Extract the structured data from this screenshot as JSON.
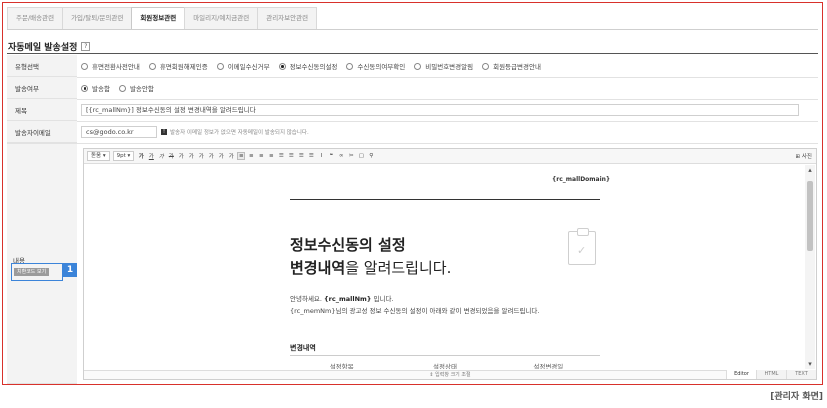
{
  "tabs": [
    {
      "label": "주문/배송관련"
    },
    {
      "label": "가입/탈퇴/문의관련"
    },
    {
      "label": "회원정보관련"
    },
    {
      "label": "마일리지/예치금관련"
    },
    {
      "label": "관리자보안관련"
    }
  ],
  "active_tab": "회원정보관련",
  "section": {
    "title": "자동메일 발송설정",
    "help": "?"
  },
  "form": {
    "type_label": "유형선택",
    "type_options": [
      {
        "label": "휴면전환사전안내",
        "checked": false
      },
      {
        "label": "휴면회원해제인증",
        "checked": false
      },
      {
        "label": "이메일수신거부",
        "checked": false
      },
      {
        "label": "정보수신동의설정",
        "checked": true
      },
      {
        "label": "수신동의여부확인",
        "checked": false
      },
      {
        "label": "비밀번호변경알림",
        "checked": false
      },
      {
        "label": "회원등급변경안내",
        "checked": false
      }
    ],
    "send_label": "발송여부",
    "send_options": [
      {
        "label": "발송함",
        "checked": true
      },
      {
        "label": "발송안함",
        "checked": false
      }
    ],
    "subject_label": "제목",
    "subject_value": "[{rc_mallNm}] 정보수신동의 설정 변경내역을 알려드립니다",
    "sender_label": "발송자이메일",
    "sender_value": "cs@godo.co.kr",
    "sender_note_icon": "!",
    "sender_note": "발송자 이메일 정보가 없으면 자동메일이 발송되지 않습니다.",
    "content_label": "내용",
    "code_button": "치환코드 보기",
    "callout_number": "1"
  },
  "editor": {
    "font_select": "돋움",
    "size_select": "9pt",
    "buttons": [
      "가",
      "가",
      "가",
      "가",
      "가",
      "가",
      "가",
      "가",
      "가",
      "가",
      "≡",
      "≡",
      "≡",
      "≡",
      "☰",
      "☰",
      "☰",
      "☰",
      "I",
      "❝",
      "∞",
      "✂",
      "▢",
      "⚲"
    ],
    "right_label": "사진",
    "domain_code": "{rc_mallDomain}",
    "headline_line1": "정보수신동의 설정",
    "headline_bold": "변경내역",
    "headline_rest": "을 알려드립니다.",
    "greeting_prefix": "안녕하세요. ",
    "greeting_code": "{rc_mallNm}",
    "greeting_suffix": " 입니다.",
    "body_line": "{rc_memNm}님의 광고성 정보 수신동의 설정이 아래와 같이 변경되었음을 알려드립니다.",
    "change_title": "변경내역",
    "table_headers": [
      "설정항목",
      "설정상태",
      "설정변경일"
    ],
    "resize_label": "⇕ 입력창 크기 조절",
    "modes": [
      "Editor",
      "HTML",
      "TEXT"
    ],
    "active_mode": "Editor"
  },
  "caption": "[관리자 화면]",
  "colors": {
    "frame": "#d8312b",
    "callout": "#3b84d9"
  }
}
